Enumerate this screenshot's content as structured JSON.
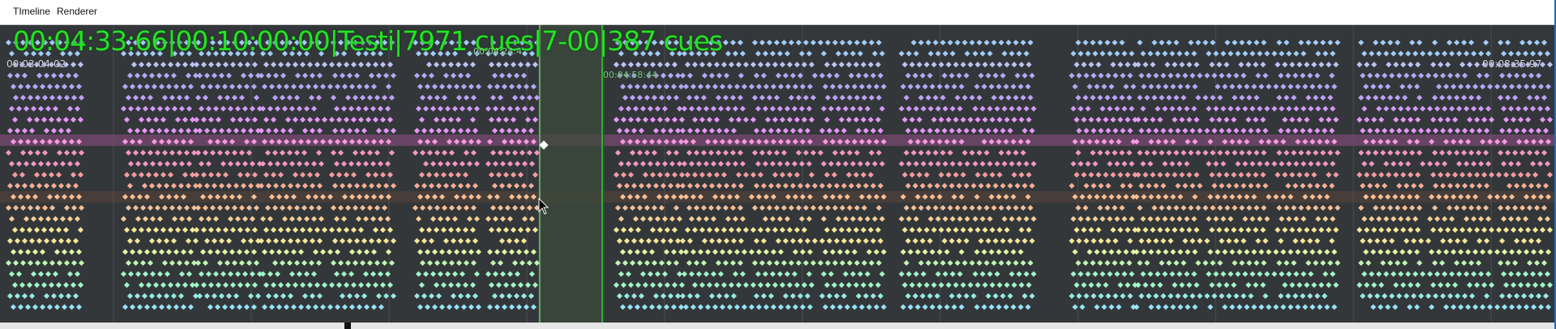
{
  "menu": {
    "timeline_label": "TImeline",
    "renderer_label": "Renderer"
  },
  "status_readout": "00:04:33:66|00:10:00:00|Testi|7971 cues|7-00|387 cues",
  "time_left": "00:03:04:02",
  "time_right": "00:08:35:97",
  "time_mid": "00:04:24:4",
  "time_mid2": "00:04:58:44",
  "colors": {
    "accent_green": "#22e422",
    "playhead_green": "#2fcf2f",
    "lane_palette": [
      "#a9d4ff",
      "#c5c9ff",
      "#b8b0ff",
      "#c7a6ff",
      "#dca0ff",
      "#f09cff",
      "#ff9ee8",
      "#ff9cc8",
      "#ffa0a8",
      "#ffb49a",
      "#ffc69a",
      "#ffd89c",
      "#fff09e",
      "#eaffaa",
      "#c8ffb8",
      "#a8ffd0",
      "#9cf5ec",
      "#9cecff"
    ]
  },
  "icons": {
    "cursor": "mouse-pointer-icon"
  }
}
